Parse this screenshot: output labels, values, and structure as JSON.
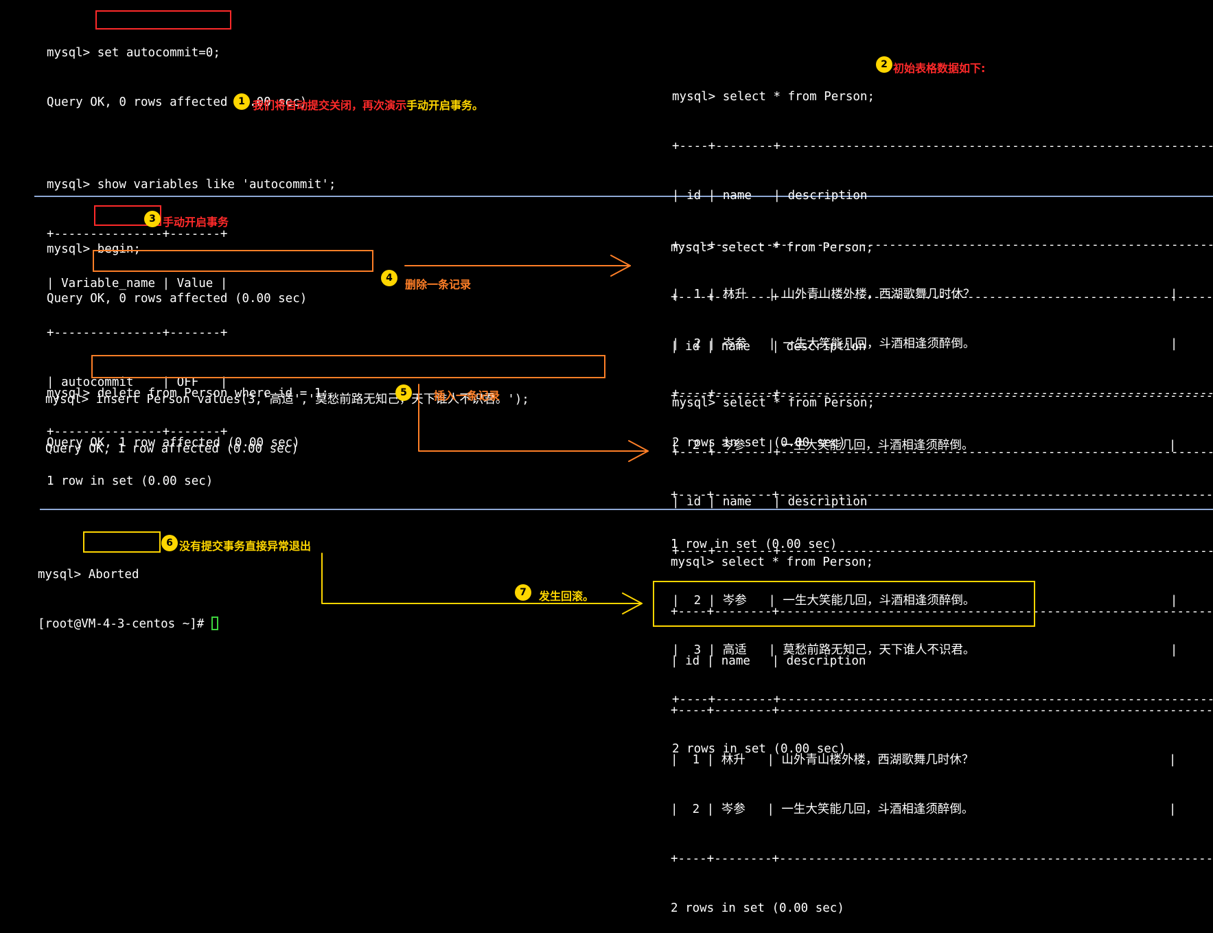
{
  "colors": {
    "background": "#000000",
    "text": "#ffffff",
    "red": "#ff2a2a",
    "orange": "#ff7f27",
    "yellow": "#ffd600",
    "separator": "#8fa9d6",
    "cursor": "#3dd43d"
  },
  "section1": {
    "left": [
      "mysql> set autocommit=0;",
      "Query OK, 0 rows affected (0.00 sec)",
      "",
      "mysql> show variables like 'autocommit';",
      "+---------------+-------+",
      "| Variable_name | Value |",
      "+---------------+-------+",
      "| autocommit    | OFF   |",
      "+---------------+-------+",
      "1 row in set (0.00 sec)"
    ],
    "right": [
      "mysql> select * from Person;",
      "+----+--------+------------------------------------------------------------+",
      "| id | name   | description                                                |",
      "+----+--------+------------------------------------------------------------+",
      "|  1 | 林升   | 山外青山楼外楼，西湖歌舞几时休？                           |",
      "|  2 | 岑参   | 一生大笑能几回，斗酒相逢须醉倒。                           |",
      "+----+--------+------------------------------------------------------------+",
      "2 rows in set (0.00 sec)"
    ]
  },
  "section2": {
    "left": [
      "mysql> begin;",
      "Query OK, 0 rows affected (0.00 sec)",
      "",
      "mysql> delete from Person where id = 1;",
      "Query OK, 1 row affected (0.00 sec)"
    ],
    "right": [
      "mysql> select * from Person;",
      "+----+--------+------------------------------------------------------------+",
      "| id | name   | description                                                |",
      "+----+--------+------------------------------------------------------------+",
      "|  2 | 岑参   | 一生大笑能几回，斗酒相逢须醉倒。                           |",
      "+----+--------+------------------------------------------------------------+",
      "1 row in set (0.00 sec)"
    ]
  },
  "section3": {
    "left": [
      "mysql> insert Person values(3,'高适','莫愁前路无知己，天下谁人不识君。');",
      "Query OK, 1 row affected (0.00 sec)"
    ],
    "right": [
      "mysql> select * from Person;",
      "+----+--------+------------------------------------------------------------+",
      "| id | name   | description                                                |",
      "+----+--------+------------------------------------------------------------+",
      "|  2 | 岑参   | 一生大笑能几回，斗酒相逢须醉倒。                           |",
      "|  3 | 高适   | 莫愁前路无知己，天下谁人不识君。                           |",
      "+----+--------+------------------------------------------------------------+",
      "2 rows in set (0.00 sec)"
    ]
  },
  "section4": {
    "left_line1": "mysql> Aborted",
    "left_line2": "[root@VM-4-3-centos ~]# ",
    "right": [
      "mysql> select * from Person;",
      "+----+--------+------------------------------------------------------------+",
      "| id | name   | description                                                |",
      "+----+--------+------------------------------------------------------------+",
      "|  1 | 林升   | 山外青山楼外楼，西湖歌舞几时休？                           |",
      "|  2 | 岑参   | 一生大笑能几回，斗酒相逢须醉倒。                           |",
      "+----+--------+------------------------------------------------------------+",
      "2 rows in set (0.00 sec)"
    ]
  },
  "annotations": {
    "a1_red": "我们将自动提交关闭，再次演示",
    "a1_yellow": "手动开启事务。",
    "a2": "初始表格数据如下:",
    "a3": "手动开启事务",
    "a4": "删除一条记录",
    "a5": "插入一条记录",
    "a6": "没有提交事务直接异常退出",
    "a7": "发生回滚。"
  },
  "badges": [
    "1",
    "2",
    "3",
    "4",
    "5",
    "6",
    "7"
  ]
}
